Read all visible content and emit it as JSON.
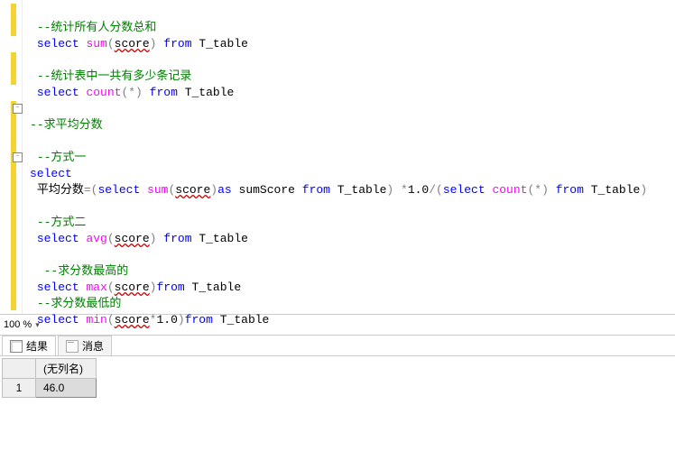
{
  "code": {
    "c1": "--统计所有人分数总和",
    "l2a": "select",
    "l2b": "sum",
    "l2c": "score",
    "l2d": "from",
    "l2e": "T_table",
    "c2": "--统计表中一共有多少条记录",
    "l4a": "select",
    "l4b": "count",
    "l4c": "*",
    "l4d": "from",
    "l4e": "T_table",
    "c3": "--求平均分数",
    "c4": "--方式一",
    "l8a": "select",
    "l9a": "平均分数",
    "l9b": "select",
    "l9c": "sum",
    "l9d": "score",
    "l9e": "as",
    "l9f": "sumScore",
    "l9g": "from",
    "l9h": "T_table",
    "l9i": "1.0",
    "l9j": "select",
    "l9k": "count",
    "l9l": "*",
    "l9m": "from",
    "l9n": "T_table",
    "c5": "--方式二",
    "l11a": "select",
    "l11b": "avg",
    "l11c": "score",
    "l11d": "from",
    "l11e": "T_table",
    "c6": " --求分数最高的",
    "l13a": "select",
    "l13b": "max",
    "l13c": "score",
    "l13d": "from",
    "l13e": "T_table",
    "c7": "--求分数最低的",
    "l15a": "select",
    "l15b": "min",
    "l15c": "score",
    "l15d": "1.0",
    "l15e": "from",
    "l15f": "T_table"
  },
  "zoom": "100 %",
  "tabs": {
    "results": "结果",
    "messages": "消息"
  },
  "grid": {
    "header": "(无列名)",
    "rownum": "1",
    "value": "46.0"
  }
}
